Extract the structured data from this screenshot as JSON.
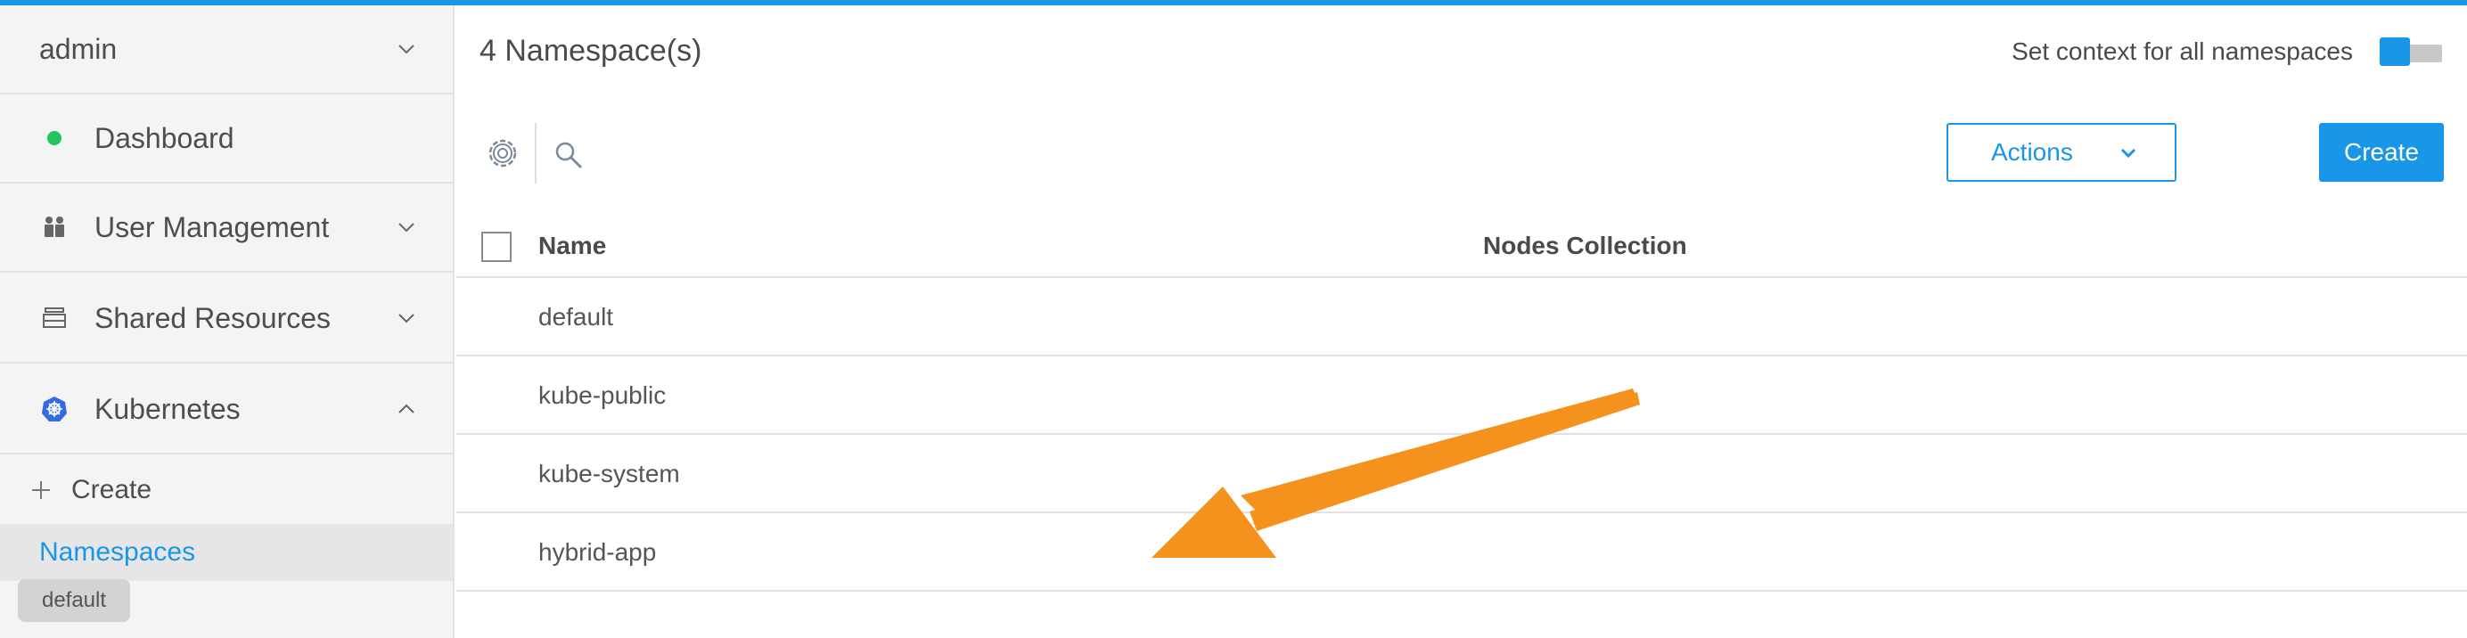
{
  "sidebar": {
    "user": "admin",
    "items": [
      {
        "label": "Dashboard",
        "status_color": "#22c55e"
      },
      {
        "label": "User Management"
      },
      {
        "label": "Shared Resources"
      },
      {
        "label": "Kubernetes"
      }
    ],
    "kubernetes_sub": {
      "create_label": "Create",
      "namespaces_label": "Namespaces",
      "namespace_tag": "default"
    }
  },
  "main": {
    "title": "4 Namespace(s)",
    "context_label": "Set context for all namespaces",
    "context_toggle_on": true,
    "actions_label": "Actions",
    "create_label": "Create",
    "table": {
      "columns": [
        "Name",
        "Nodes Collection"
      ],
      "rows": [
        {
          "name": "default",
          "nodes": ""
        },
        {
          "name": "kube-public",
          "nodes": ""
        },
        {
          "name": "kube-system",
          "nodes": ""
        },
        {
          "name": "hybrid-app",
          "nodes": ""
        }
      ]
    }
  },
  "colors": {
    "accent": "#1a96e8",
    "annotation_arrow": "#f5921e"
  }
}
